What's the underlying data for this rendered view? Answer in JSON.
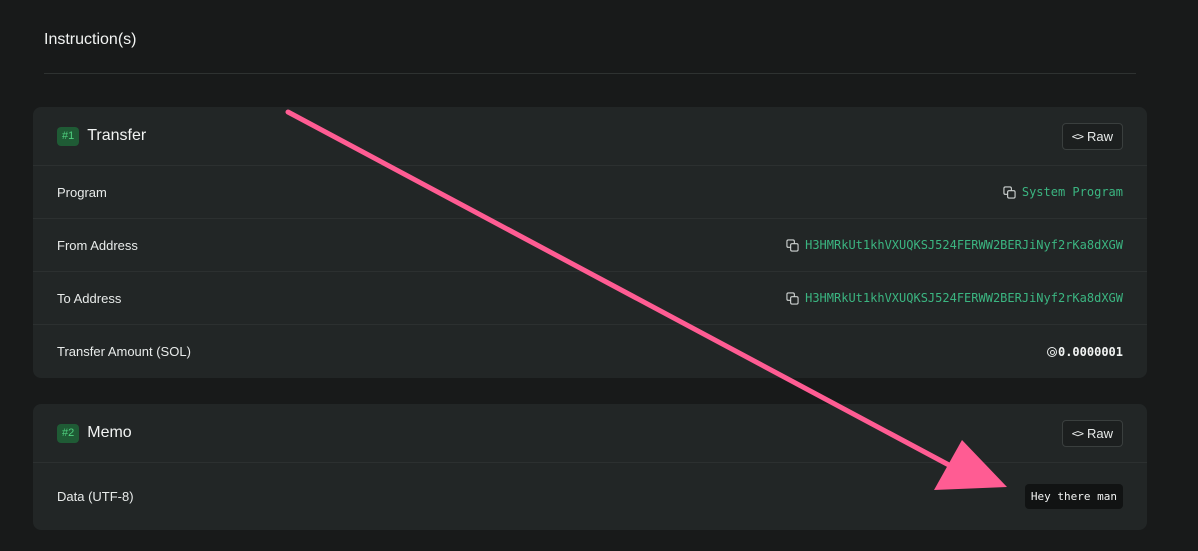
{
  "section": {
    "title": "Instruction(s)"
  },
  "instructions": [
    {
      "badge": "#1",
      "title": "Transfer",
      "raw_label": "Raw",
      "rows": [
        {
          "label": "Program",
          "value": "System Program",
          "type": "link",
          "copy_icon": "copy-icon"
        },
        {
          "label": "From Address",
          "value": "H3HMRkUt1khVXUQKSJ524FERWW2BERJiNyf2rKa8dXGW",
          "type": "link",
          "copy_icon": "copy-icon"
        },
        {
          "label": "To Address",
          "value": "H3HMRkUt1khVXUQKSJ524FERWW2BERJiNyf2rKa8dXGW",
          "type": "link",
          "copy_icon": "copy-icon"
        },
        {
          "label": "Transfer Amount (SOL)",
          "value": "0.0000001",
          "type": "sol",
          "icon": "sol-icon"
        }
      ]
    },
    {
      "badge": "#2",
      "title": "Memo",
      "raw_label": "Raw",
      "rows": [
        {
          "label": "Data (UTF-8)",
          "value": "Hey there man",
          "type": "memo"
        }
      ]
    }
  ],
  "annotation": {
    "arrow_color": "#ff5c93",
    "icon": "pink-arrow-annotation"
  },
  "colors": {
    "background": "#181a1a",
    "card": "#222626",
    "link": "#3bb581",
    "badge_bg": "#1f5b35",
    "badge_text": "#4fd07f"
  }
}
